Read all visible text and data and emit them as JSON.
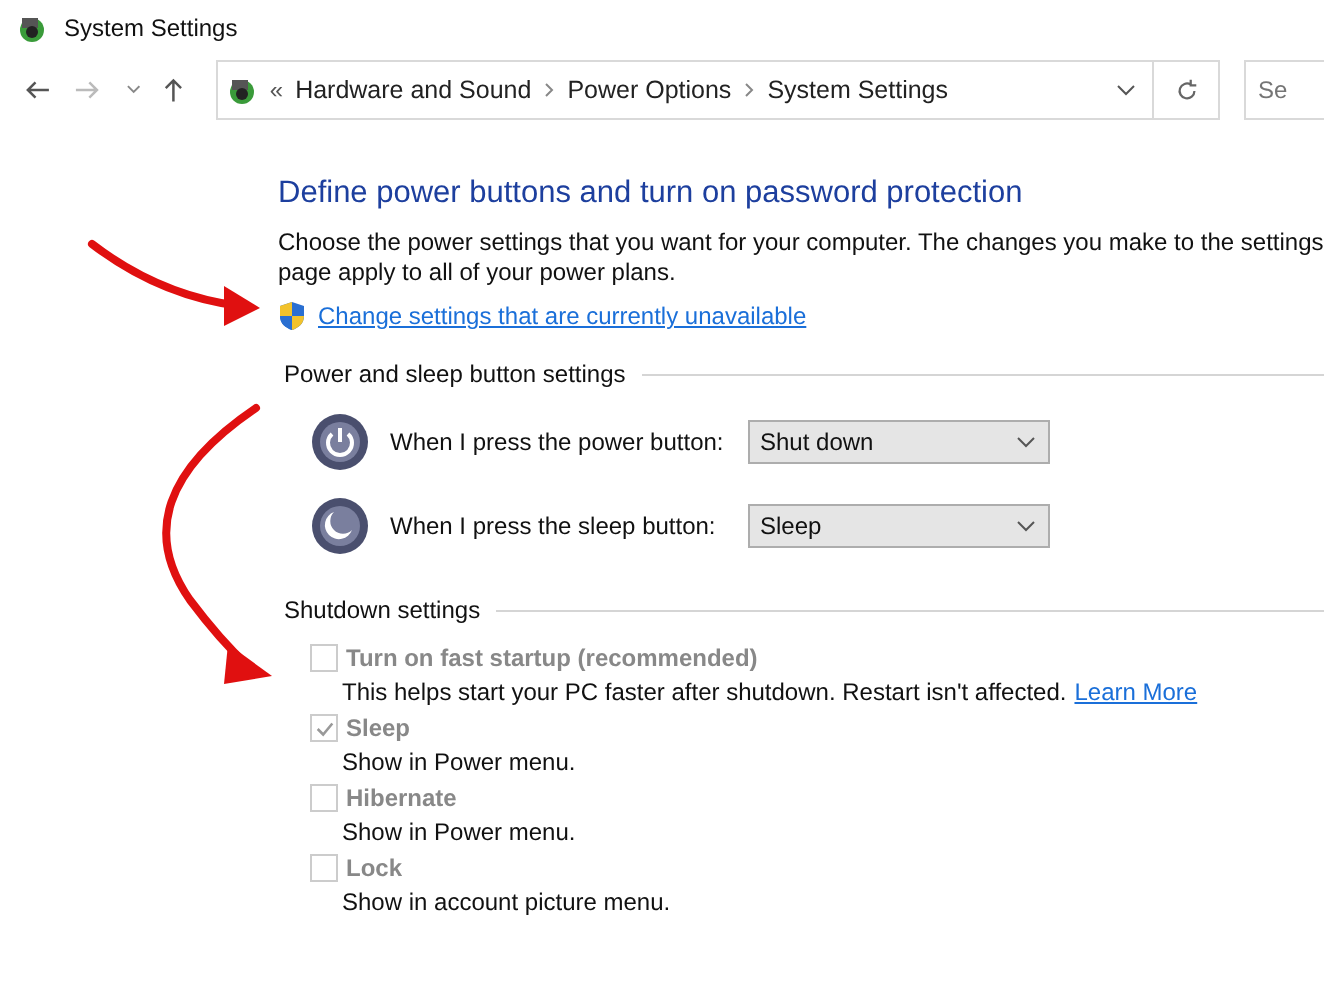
{
  "window": {
    "title": "System Settings"
  },
  "address_bar": {
    "overflow": "«",
    "crumbs": [
      "Hardware and Sound",
      "Power Options",
      "System Settings"
    ]
  },
  "search": {
    "placeholder": "Se"
  },
  "heading": "Define power buttons and turn on password protection",
  "description_lines": [
    "Choose the power settings that you want for your computer. The changes you make to the settings",
    "page apply to all of your power plans."
  ],
  "admin_link": "Change settings that are currently unavailable",
  "button_section": {
    "title": "Power and sleep button settings",
    "rows": [
      {
        "kind": "power",
        "label": "When I press the power button:",
        "value": "Shut down"
      },
      {
        "kind": "sleep",
        "label": "When I press the sleep button:",
        "value": "Sleep"
      }
    ]
  },
  "shutdown_section": {
    "title": "Shutdown settings",
    "items": [
      {
        "label": "Turn on fast startup (recommended)",
        "checked": false,
        "disabled": true,
        "description": "This helps start your PC faster after shutdown. Restart isn't affected.",
        "link": "Learn More"
      },
      {
        "label": "Sleep",
        "checked": true,
        "disabled": true,
        "description": "Show in Power menu."
      },
      {
        "label": "Hibernate",
        "checked": false,
        "disabled": true,
        "description": "Show in Power menu."
      },
      {
        "label": "Lock",
        "checked": false,
        "disabled": true,
        "description": "Show in account picture menu."
      }
    ]
  }
}
